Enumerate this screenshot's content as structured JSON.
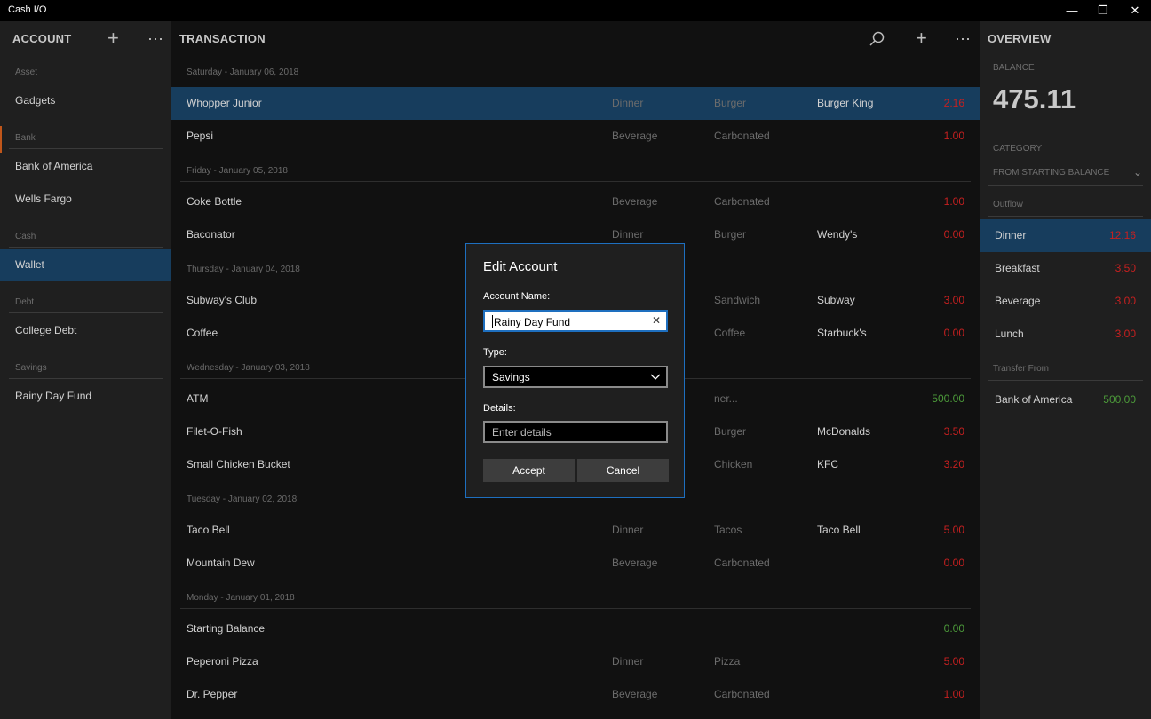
{
  "window": {
    "title": "Cash I/O",
    "minimize": "—",
    "restore": "❐",
    "close": "✕"
  },
  "account_pane": {
    "header": "ACCOUNT",
    "add_icon": "+",
    "more_icon": "⋯",
    "groups": [
      {
        "label": "Asset",
        "items": [
          "Gadgets"
        ]
      },
      {
        "label": "Bank",
        "items": [
          "Bank of America",
          "Wells Fargo"
        ]
      },
      {
        "label": "Cash",
        "items": [
          "Wallet"
        ]
      },
      {
        "label": "Debt",
        "items": [
          "College Debt"
        ]
      },
      {
        "label": "Savings",
        "items": [
          "Rainy Day Fund"
        ]
      }
    ],
    "selected": "Wallet"
  },
  "transaction_pane": {
    "header": "TRANSACTION",
    "search_icon": "⌕",
    "add_icon": "+",
    "more_icon": "⋯",
    "days": [
      {
        "date": "Saturday - January 06, 2018",
        "rows": [
          {
            "name": "Whopper Junior",
            "category": "Dinner",
            "subcategory": "Burger",
            "vendor": "Burger King",
            "amount": "2.16",
            "sign": "neg"
          },
          {
            "name": "Pepsi",
            "category": "Beverage",
            "subcategory": "Carbonated",
            "vendor": "",
            "amount": "1.00",
            "sign": "neg"
          }
        ]
      },
      {
        "date": "Friday - January 05, 2018",
        "rows": [
          {
            "name": "Coke Bottle",
            "category": "Beverage",
            "subcategory": "Carbonated",
            "vendor": "",
            "amount": "1.00",
            "sign": "neg"
          },
          {
            "name": "Baconator",
            "category": "Dinner",
            "subcategory": "Burger",
            "vendor": "Wendy's",
            "amount": "0.00",
            "sign": "neg"
          }
        ]
      },
      {
        "date": "Thursday - January 04, 2018",
        "rows": [
          {
            "name": "Subway's Club",
            "category": "",
            "subcategory": "Sandwich",
            "vendor": "Subway",
            "amount": "3.00",
            "sign": "neg"
          },
          {
            "name": "Coffee",
            "category": "",
            "subcategory": "Coffee",
            "vendor": "Starbuck's",
            "amount": "0.00",
            "sign": "neg"
          }
        ]
      },
      {
        "date": "Wednesday - January 03, 2018",
        "rows": [
          {
            "name": "ATM",
            "category": "",
            "subcategory": "ner...",
            "vendor": "",
            "amount": "500.00",
            "sign": "pos"
          },
          {
            "name": "Filet-O-Fish",
            "category": "",
            "subcategory": "Burger",
            "vendor": "McDonalds",
            "amount": "3.50",
            "sign": "neg"
          },
          {
            "name": "Small Chicken Bucket",
            "category": "",
            "subcategory": "Chicken",
            "vendor": "KFC",
            "amount": "3.20",
            "sign": "neg"
          }
        ]
      },
      {
        "date": "Tuesday - January 02, 2018",
        "rows": [
          {
            "name": "Taco Bell",
            "category": "Dinner",
            "subcategory": "Tacos",
            "vendor": "Taco Bell",
            "amount": "5.00",
            "sign": "neg"
          },
          {
            "name": "Mountain Dew",
            "category": "Beverage",
            "subcategory": "Carbonated",
            "vendor": "",
            "amount": "0.00",
            "sign": "neg"
          }
        ]
      },
      {
        "date": "Monday - January 01, 2018",
        "rows": [
          {
            "name": "Starting Balance",
            "category": "",
            "subcategory": "",
            "vendor": "",
            "amount": "0.00",
            "sign": "pos"
          },
          {
            "name": "Peperoni Pizza",
            "category": "Dinner",
            "subcategory": "Pizza",
            "vendor": "",
            "amount": "5.00",
            "sign": "neg"
          },
          {
            "name": "Dr. Pepper",
            "category": "Beverage",
            "subcategory": "Carbonated",
            "vendor": "",
            "amount": "1.00",
            "sign": "neg"
          }
        ]
      }
    ]
  },
  "overview_pane": {
    "header": "OVERVIEW",
    "balance_label": "BALANCE",
    "balance": "475.11",
    "category_label": "CATEGORY",
    "category_value": "FROM STARTING BALANCE",
    "chevron_icon": "⌄",
    "outflow_label": "Outflow",
    "outflow": [
      {
        "name": "Dinner",
        "amount": "12.16"
      },
      {
        "name": "Breakfast",
        "amount": "3.50"
      },
      {
        "name": "Beverage",
        "amount": "3.00"
      },
      {
        "name": "Lunch",
        "amount": "3.00"
      }
    ],
    "transfer_label": "Transfer From",
    "transfer": [
      {
        "name": "Bank of America",
        "amount": "500.00"
      }
    ]
  },
  "dialog": {
    "title": "Edit Account",
    "name_label": "Account Name:",
    "name_value": "Rainy Day Fund",
    "clear_icon": "✕",
    "type_label": "Type:",
    "type_value": "Savings",
    "details_label": "Details:",
    "details_placeholder": "Enter details",
    "accept": "Accept",
    "cancel": "Cancel"
  },
  "colors": {
    "selection": "#173d5d",
    "accent": "#1e6fbf",
    "negative": "#c62020",
    "positive": "#4c9a3a"
  }
}
